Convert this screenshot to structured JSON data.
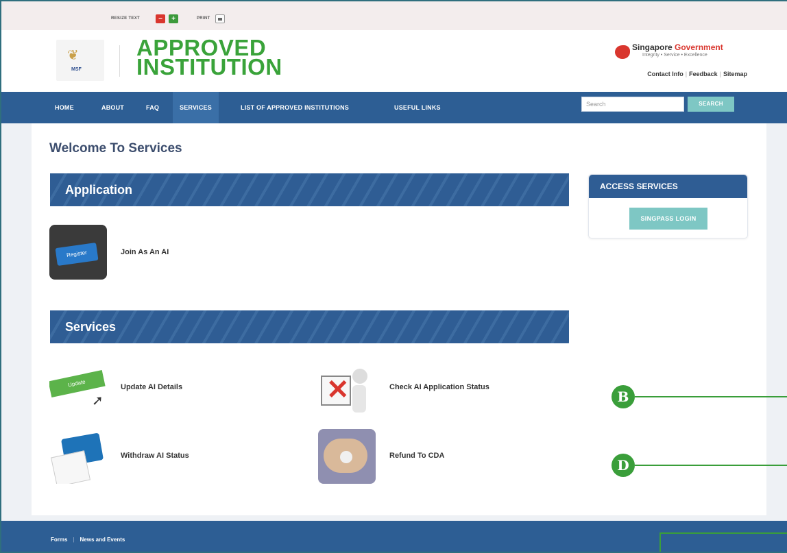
{
  "utility": {
    "resize_text_label": "RESIZE TEXT",
    "minus_symbol": "−",
    "plus_symbol": "+",
    "print_label": "PRINT"
  },
  "header": {
    "logo_text": "MSF",
    "site_title_line1": "APPROVED",
    "site_title_line2": "INSTITUTION",
    "gov_name_1": "Singapore ",
    "gov_name_2": "Government",
    "gov_tagline": "Integrity • Service • Excellence",
    "links": [
      "Contact Info",
      "Feedback",
      "Sitemap"
    ]
  },
  "nav": {
    "items": [
      "HOME",
      "ABOUT",
      "FAQ",
      "SERVICES",
      "LIST OF APPROVED INSTITUTIONS",
      "USEFUL LINKS"
    ],
    "active": "SERVICES",
    "search_placeholder": "Search",
    "search_button": "SEARCH"
  },
  "main": {
    "page_title": "Welcome To Services",
    "application_heading": "Application",
    "application_items": [
      {
        "label": "Join As An AI",
        "icon": "register-keyboard-icon"
      }
    ],
    "services_heading": "Services",
    "services_items": [
      {
        "label": "Update AI Details",
        "icon": "update-icon"
      },
      {
        "label": "Check AI Application Status",
        "icon": "check-status-icon"
      },
      {
        "label": "Withdraw AI Status",
        "icon": "withdraw-icon"
      },
      {
        "label": "Refund To CDA",
        "icon": "refund-icon"
      }
    ]
  },
  "access": {
    "heading": "ACCESS SERVICES",
    "button": "SINGPASS LOGIN"
  },
  "callouts": [
    "B",
    "D"
  ],
  "footer": {
    "links": [
      "Forms",
      "News and Events"
    ]
  },
  "colors": {
    "nav_blue": "#2d5e94",
    "title_green": "#3aa33a",
    "accent_teal": "#7ec7c4",
    "callout_green": "#3a9e3a",
    "gov_red": "#d9362e"
  }
}
